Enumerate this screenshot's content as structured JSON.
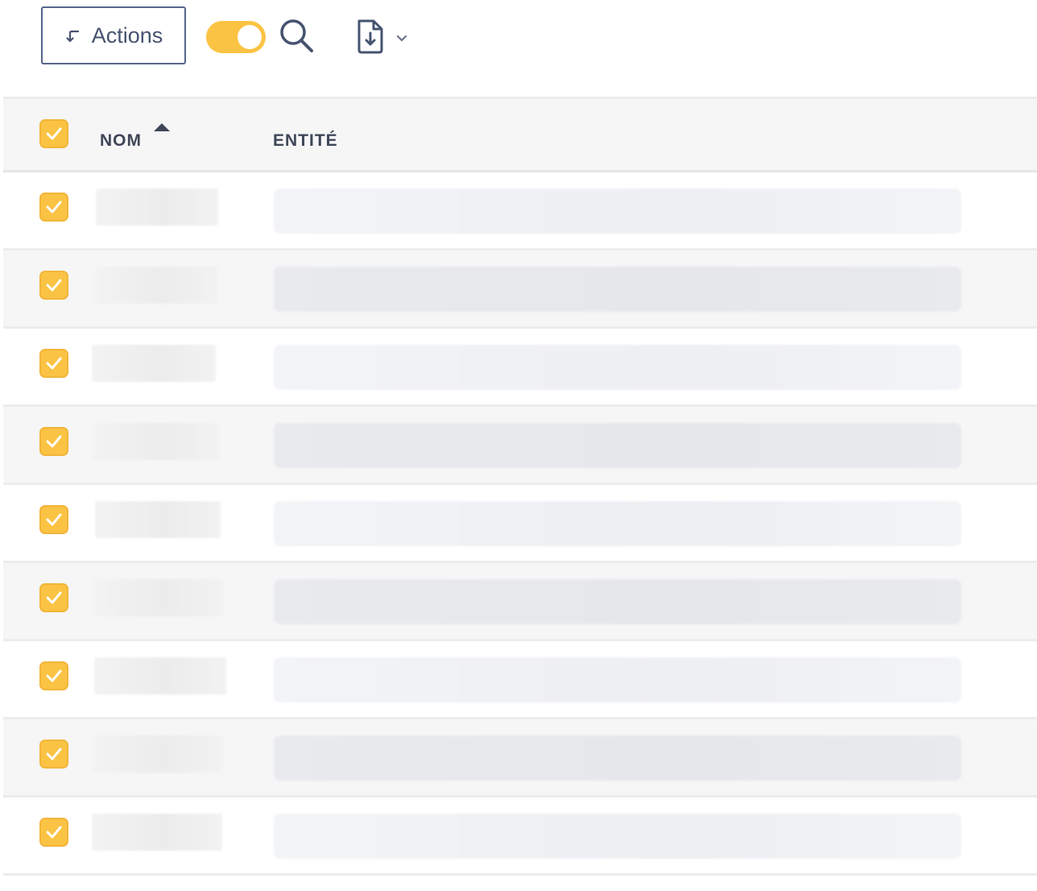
{
  "toolbar": {
    "actions_label": "Actions",
    "actions_icon": "return-arrow-icon",
    "toggle_on": true,
    "search_icon": "search-icon",
    "export_icon": "file-download-icon",
    "export_dropdown_icon": "chevron-down-icon"
  },
  "table": {
    "columns": [
      {
        "label": "NOM",
        "sorted": "ascending"
      },
      {
        "label": "ENTITÉ"
      }
    ],
    "select_all_checked": true,
    "rows": [
      {
        "checked": true,
        "loading": true
      },
      {
        "checked": true,
        "loading": true
      },
      {
        "checked": true,
        "loading": true
      },
      {
        "checked": true,
        "loading": true
      },
      {
        "checked": true,
        "loading": true
      },
      {
        "checked": true,
        "loading": true
      },
      {
        "checked": true,
        "loading": true
      },
      {
        "checked": true,
        "loading": true
      },
      {
        "checked": true,
        "loading": true
      }
    ]
  },
  "colors": {
    "accent": "#fbc343",
    "border": "#55658a",
    "text": "#3f4657",
    "row_alt": "#f6f6f7"
  }
}
